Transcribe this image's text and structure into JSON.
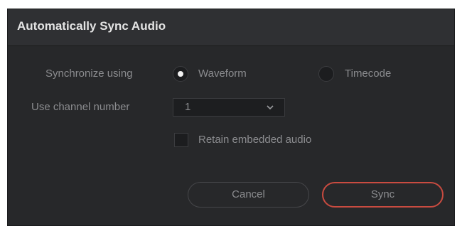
{
  "dialog": {
    "title": "Automatically Sync Audio",
    "synchronize_label": "Synchronize using",
    "options": [
      {
        "label": "Waveform",
        "checked": true
      },
      {
        "label": "Timecode",
        "checked": false
      }
    ],
    "channel_label": "Use channel number",
    "channel_value": "1",
    "retain_label": "Retain embedded audio",
    "retain_checked": false,
    "cancel_label": "Cancel",
    "sync_label": "Sync"
  },
  "colors": {
    "background": "#27282a",
    "titlebar": "#2f3033",
    "accent_sync_border": "#c94b40",
    "text_muted": "#8b8c8f"
  },
  "icons": {
    "dropdown": "chevron-down-icon"
  }
}
